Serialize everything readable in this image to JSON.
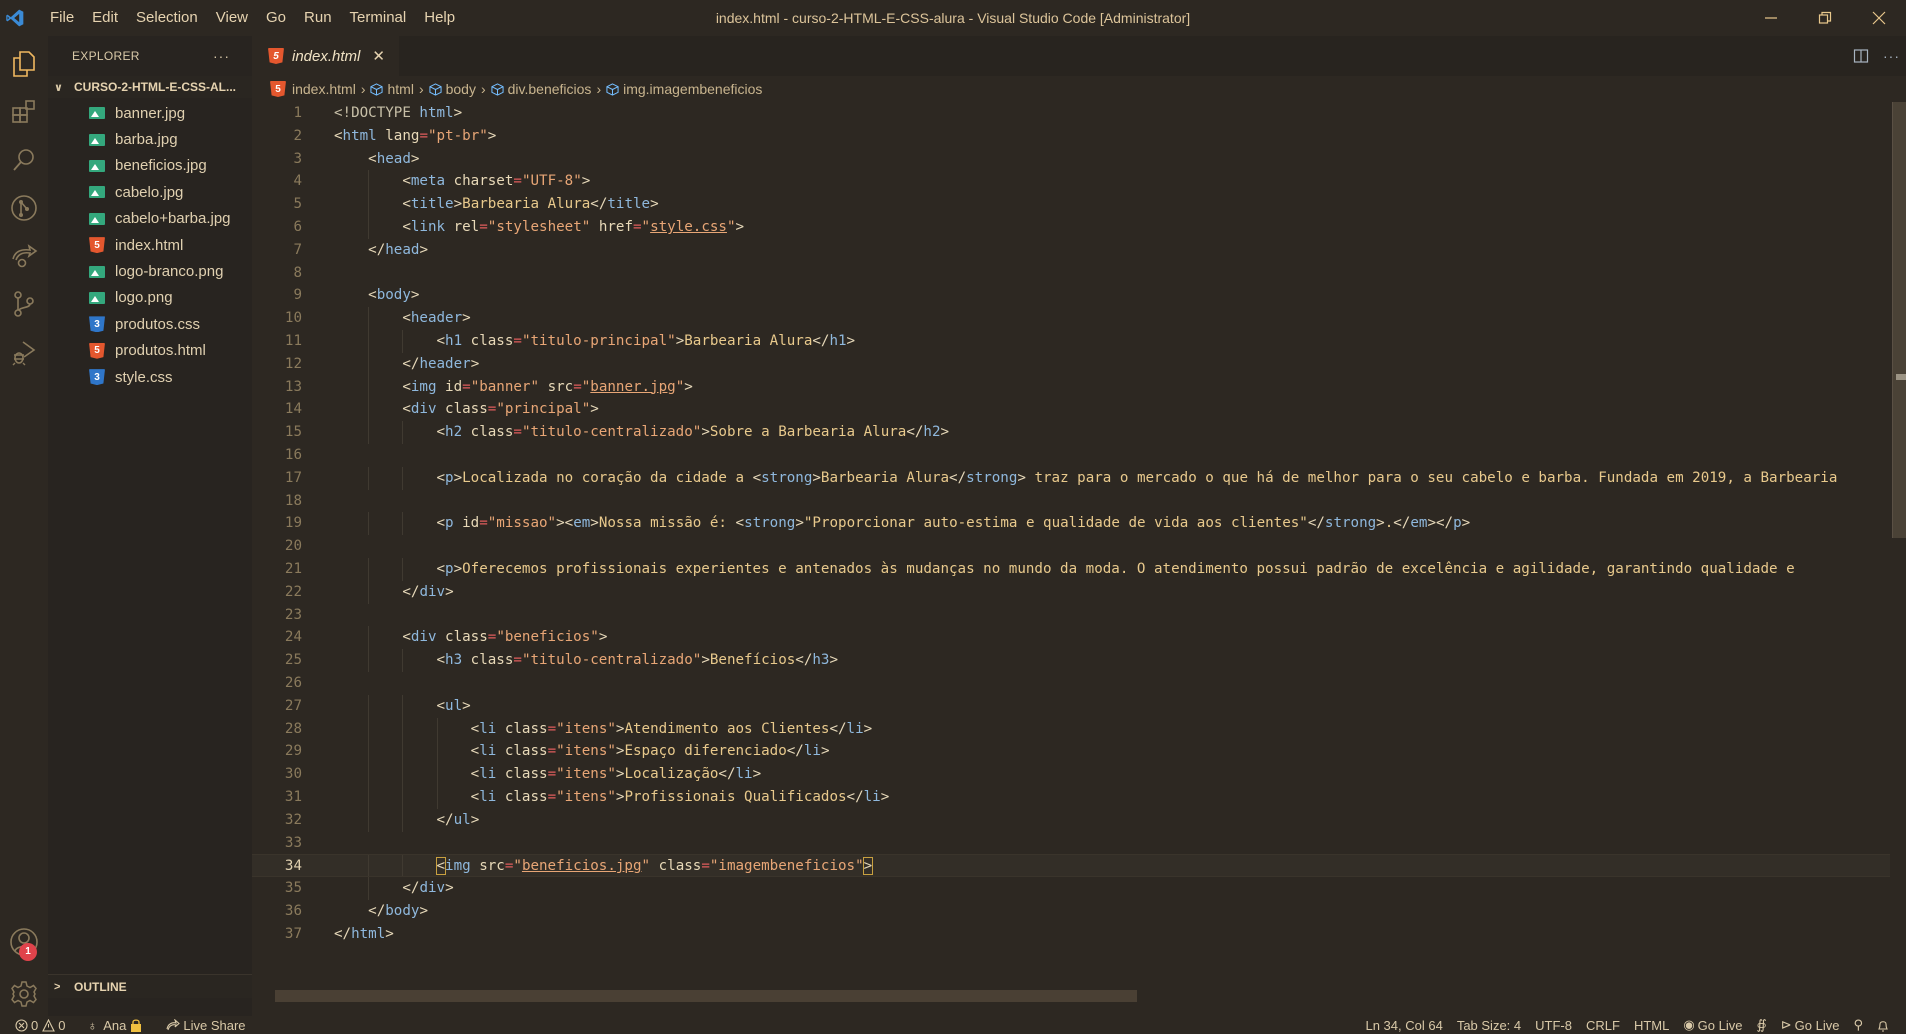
{
  "window": {
    "title": "index.html - curso-2-HTML-E-CSS-alura - Visual Studio Code [Administrator]",
    "accent": "#3b8bd6"
  },
  "menu": [
    "File",
    "Edit",
    "Selection",
    "View",
    "Go",
    "Run",
    "Terminal",
    "Help"
  ],
  "activity_bar": {
    "items": [
      "files-icon",
      "extensions-icon",
      "search-icon",
      "git-graph-icon",
      "live-share-icon",
      "source-control-icon",
      "run-debug-icon"
    ],
    "accounts_badge": "1"
  },
  "explorer": {
    "header": "EXPLORER",
    "more": "···",
    "folder": "CURSO-2-HTML-E-CSS-AL...",
    "files": [
      {
        "name": "banner.jpg",
        "type": "image"
      },
      {
        "name": "barba.jpg",
        "type": "image"
      },
      {
        "name": "beneficios.jpg",
        "type": "image"
      },
      {
        "name": "cabelo.jpg",
        "type": "image"
      },
      {
        "name": "cabelo+barba.jpg",
        "type": "image"
      },
      {
        "name": "index.html",
        "type": "html"
      },
      {
        "name": "logo-branco.png",
        "type": "image"
      },
      {
        "name": "logo.png",
        "type": "image"
      },
      {
        "name": "produtos.css",
        "type": "css"
      },
      {
        "name": "produtos.html",
        "type": "html"
      },
      {
        "name": "style.css",
        "type": "css"
      }
    ],
    "outline_label": "OUTLINE"
  },
  "editor": {
    "tab": {
      "label": "index.html",
      "close": "✕"
    },
    "breadcrumb": [
      "index.html",
      "html",
      "body",
      "div.beneficios",
      "img.imagembeneficios"
    ],
    "current_line": 34,
    "lines": [
      [
        [
          "doc",
          "<!DOCTYPE "
        ],
        [
          "t",
          "html"
        ],
        [
          "b",
          ">"
        ]
      ],
      [
        [
          "b",
          "<"
        ],
        [
          "t",
          "html"
        ],
        [
          "a",
          " lang"
        ],
        [
          "e",
          "="
        ],
        [
          "s",
          "\"pt-br\""
        ],
        [
          "b",
          ">"
        ]
      ],
      [
        [
          "i",
          1
        ],
        [
          "b",
          "<"
        ],
        [
          "t",
          "head"
        ],
        [
          "b",
          ">"
        ]
      ],
      [
        [
          "i",
          2
        ],
        [
          "b",
          "<"
        ],
        [
          "t",
          "meta"
        ],
        [
          "a",
          " charset"
        ],
        [
          "e",
          "="
        ],
        [
          "s",
          "\"UTF-8\""
        ],
        [
          "b",
          ">"
        ]
      ],
      [
        [
          "i",
          2
        ],
        [
          "b",
          "<"
        ],
        [
          "t",
          "title"
        ],
        [
          "b",
          ">"
        ],
        [
          "x",
          "Barbearia Alura"
        ],
        [
          "b",
          "</"
        ],
        [
          "t",
          "title"
        ],
        [
          "b",
          ">"
        ]
      ],
      [
        [
          "i",
          2
        ],
        [
          "b",
          "<"
        ],
        [
          "t",
          "link"
        ],
        [
          "a",
          " rel"
        ],
        [
          "e",
          "="
        ],
        [
          "s",
          "\"stylesheet\""
        ],
        [
          "a",
          " href"
        ],
        [
          "e",
          "="
        ],
        [
          "s",
          "\""
        ],
        [
          "u",
          "style.css"
        ],
        [
          "s",
          "\""
        ],
        [
          "b",
          ">"
        ]
      ],
      [
        [
          "i",
          1
        ],
        [
          "b",
          "</"
        ],
        [
          "t",
          "head"
        ],
        [
          "b",
          ">"
        ]
      ],
      [],
      [
        [
          "i",
          1
        ],
        [
          "b",
          "<"
        ],
        [
          "t",
          "body"
        ],
        [
          "b",
          ">"
        ]
      ],
      [
        [
          "i",
          2
        ],
        [
          "b",
          "<"
        ],
        [
          "t",
          "header"
        ],
        [
          "b",
          ">"
        ]
      ],
      [
        [
          "i",
          3
        ],
        [
          "b",
          "<"
        ],
        [
          "t",
          "h1"
        ],
        [
          "a",
          " class"
        ],
        [
          "e",
          "="
        ],
        [
          "s",
          "\"titulo-principal\""
        ],
        [
          "b",
          ">"
        ],
        [
          "x",
          "Barbearia Alura"
        ],
        [
          "b",
          "</"
        ],
        [
          "t",
          "h1"
        ],
        [
          "b",
          ">"
        ]
      ],
      [
        [
          "i",
          2
        ],
        [
          "b",
          "</"
        ],
        [
          "t",
          "header"
        ],
        [
          "b",
          ">"
        ]
      ],
      [
        [
          "i",
          2
        ],
        [
          "b",
          "<"
        ],
        [
          "t",
          "img"
        ],
        [
          "a",
          " id"
        ],
        [
          "e",
          "="
        ],
        [
          "s",
          "\"banner\""
        ],
        [
          "a",
          " src"
        ],
        [
          "e",
          "="
        ],
        [
          "s",
          "\""
        ],
        [
          "u",
          "banner.jpg"
        ],
        [
          "s",
          "\""
        ],
        [
          "b",
          ">"
        ]
      ],
      [
        [
          "i",
          2
        ],
        [
          "b",
          "<"
        ],
        [
          "t",
          "div"
        ],
        [
          "a",
          " class"
        ],
        [
          "e",
          "="
        ],
        [
          "s",
          "\"principal\""
        ],
        [
          "b",
          ">"
        ]
      ],
      [
        [
          "i",
          3
        ],
        [
          "b",
          "<"
        ],
        [
          "t",
          "h2"
        ],
        [
          "a",
          " class"
        ],
        [
          "e",
          "="
        ],
        [
          "s",
          "\"titulo-centralizado\""
        ],
        [
          "b",
          ">"
        ],
        [
          "x",
          "Sobre a Barbearia Alura"
        ],
        [
          "b",
          "</"
        ],
        [
          "t",
          "h2"
        ],
        [
          "b",
          ">"
        ]
      ],
      [],
      [
        [
          "i",
          3
        ],
        [
          "b",
          "<"
        ],
        [
          "t",
          "p"
        ],
        [
          "b",
          ">"
        ],
        [
          "x",
          "Localizada no coração da cidade a "
        ],
        [
          "b",
          "<"
        ],
        [
          "t",
          "strong"
        ],
        [
          "b",
          ">"
        ],
        [
          "x",
          "Barbearia Alura"
        ],
        [
          "b",
          "</"
        ],
        [
          "t",
          "strong"
        ],
        [
          "b",
          ">"
        ],
        [
          "x",
          " traz para o mercado o que há de melhor para o seu cabelo e barba. Fundada em 2019, a Barbearia"
        ]
      ],
      [],
      [
        [
          "i",
          3
        ],
        [
          "b",
          "<"
        ],
        [
          "t",
          "p"
        ],
        [
          "a",
          " id"
        ],
        [
          "e",
          "="
        ],
        [
          "s",
          "\"missao\""
        ],
        [
          "b",
          ">"
        ],
        [
          "b",
          "<"
        ],
        [
          "t",
          "em"
        ],
        [
          "b",
          ">"
        ],
        [
          "x",
          "Nossa missão é: "
        ],
        [
          "b",
          "<"
        ],
        [
          "t",
          "strong"
        ],
        [
          "b",
          ">"
        ],
        [
          "x",
          "\"Proporcionar auto-estima e qualidade de vida aos clientes\""
        ],
        [
          "b",
          "</"
        ],
        [
          "t",
          "strong"
        ],
        [
          "b",
          ">"
        ],
        [
          "x",
          "."
        ],
        [
          "b",
          "</"
        ],
        [
          "t",
          "em"
        ],
        [
          "b",
          ">"
        ],
        [
          "b",
          "</"
        ],
        [
          "t",
          "p"
        ],
        [
          "b",
          ">"
        ]
      ],
      [],
      [
        [
          "i",
          3
        ],
        [
          "b",
          "<"
        ],
        [
          "t",
          "p"
        ],
        [
          "b",
          ">"
        ],
        [
          "x",
          "Oferecemos profissionais experientes e antenados às mudanças no mundo da moda. O atendimento possui padrão de excelência e agilidade, garantindo qualidade e"
        ]
      ],
      [
        [
          "i",
          2
        ],
        [
          "b",
          "</"
        ],
        [
          "t",
          "div"
        ],
        [
          "b",
          ">"
        ]
      ],
      [],
      [
        [
          "i",
          2
        ],
        [
          "b",
          "<"
        ],
        [
          "t",
          "div"
        ],
        [
          "a",
          " class"
        ],
        [
          "e",
          "="
        ],
        [
          "s",
          "\"beneficios\""
        ],
        [
          "b",
          ">"
        ]
      ],
      [
        [
          "i",
          3
        ],
        [
          "b",
          "<"
        ],
        [
          "t",
          "h3"
        ],
        [
          "a",
          " class"
        ],
        [
          "e",
          "="
        ],
        [
          "s",
          "\"titulo-centralizado\""
        ],
        [
          "b",
          ">"
        ],
        [
          "x",
          "Benefícios"
        ],
        [
          "b",
          "</"
        ],
        [
          "t",
          "h3"
        ],
        [
          "b",
          ">"
        ]
      ],
      [],
      [
        [
          "i",
          3
        ],
        [
          "b",
          "<"
        ],
        [
          "t",
          "ul"
        ],
        [
          "b",
          ">"
        ]
      ],
      [
        [
          "i",
          4
        ],
        [
          "b",
          "<"
        ],
        [
          "t",
          "li"
        ],
        [
          "a",
          " class"
        ],
        [
          "e",
          "="
        ],
        [
          "s",
          "\"itens\""
        ],
        [
          "b",
          ">"
        ],
        [
          "x",
          "Atendimento aos Clientes"
        ],
        [
          "b",
          "</"
        ],
        [
          "t",
          "li"
        ],
        [
          "b",
          ">"
        ]
      ],
      [
        [
          "i",
          4
        ],
        [
          "b",
          "<"
        ],
        [
          "t",
          "li"
        ],
        [
          "a",
          " class"
        ],
        [
          "e",
          "="
        ],
        [
          "s",
          "\"itens\""
        ],
        [
          "b",
          ">"
        ],
        [
          "x",
          "Espaço diferenciado"
        ],
        [
          "b",
          "</"
        ],
        [
          "t",
          "li"
        ],
        [
          "b",
          ">"
        ]
      ],
      [
        [
          "i",
          4
        ],
        [
          "b",
          "<"
        ],
        [
          "t",
          "li"
        ],
        [
          "a",
          " class"
        ],
        [
          "e",
          "="
        ],
        [
          "s",
          "\"itens\""
        ],
        [
          "b",
          ">"
        ],
        [
          "x",
          "Localização"
        ],
        [
          "b",
          "</"
        ],
        [
          "t",
          "li"
        ],
        [
          "b",
          ">"
        ]
      ],
      [
        [
          "i",
          4
        ],
        [
          "b",
          "<"
        ],
        [
          "t",
          "li"
        ],
        [
          "a",
          " class"
        ],
        [
          "e",
          "="
        ],
        [
          "s",
          "\"itens\""
        ],
        [
          "b",
          ">"
        ],
        [
          "x",
          "Profissionais Qualificados"
        ],
        [
          "b",
          "</"
        ],
        [
          "t",
          "li"
        ],
        [
          "b",
          ">"
        ]
      ],
      [
        [
          "i",
          3
        ],
        [
          "b",
          "</"
        ],
        [
          "t",
          "ul"
        ],
        [
          "b",
          ">"
        ]
      ],
      [],
      [
        [
          "i",
          3
        ],
        [
          "m",
          "<"
        ],
        [
          "t",
          "img"
        ],
        [
          "a",
          " src"
        ],
        [
          "e",
          "="
        ],
        [
          "s",
          "\""
        ],
        [
          "u",
          "beneficios.jpg"
        ],
        [
          "s",
          "\""
        ],
        [
          "a",
          " class"
        ],
        [
          "e",
          "="
        ],
        [
          "s",
          "\"imagembeneficios\""
        ],
        [
          "m",
          ">"
        ]
      ],
      [
        [
          "i",
          2
        ],
        [
          "b",
          "</"
        ],
        [
          "t",
          "div"
        ],
        [
          "b",
          ">"
        ]
      ],
      [
        [
          "i",
          1
        ],
        [
          "b",
          "</"
        ],
        [
          "t",
          "body"
        ],
        [
          "b",
          ">"
        ]
      ],
      [
        [
          "b",
          "</"
        ],
        [
          "t",
          "html"
        ],
        [
          "b",
          ">"
        ]
      ]
    ]
  },
  "statusbar": {
    "errors": "0",
    "warnings": "0",
    "user": "Ana",
    "live_share": "Live Share",
    "position": "Ln 34, Col 64",
    "tab_size": "Tab Size: 4",
    "encoding": "UTF-8",
    "eol": "CRLF",
    "language": "HTML",
    "go_live_1": "Go Live",
    "go_live_2": "Go Live"
  }
}
